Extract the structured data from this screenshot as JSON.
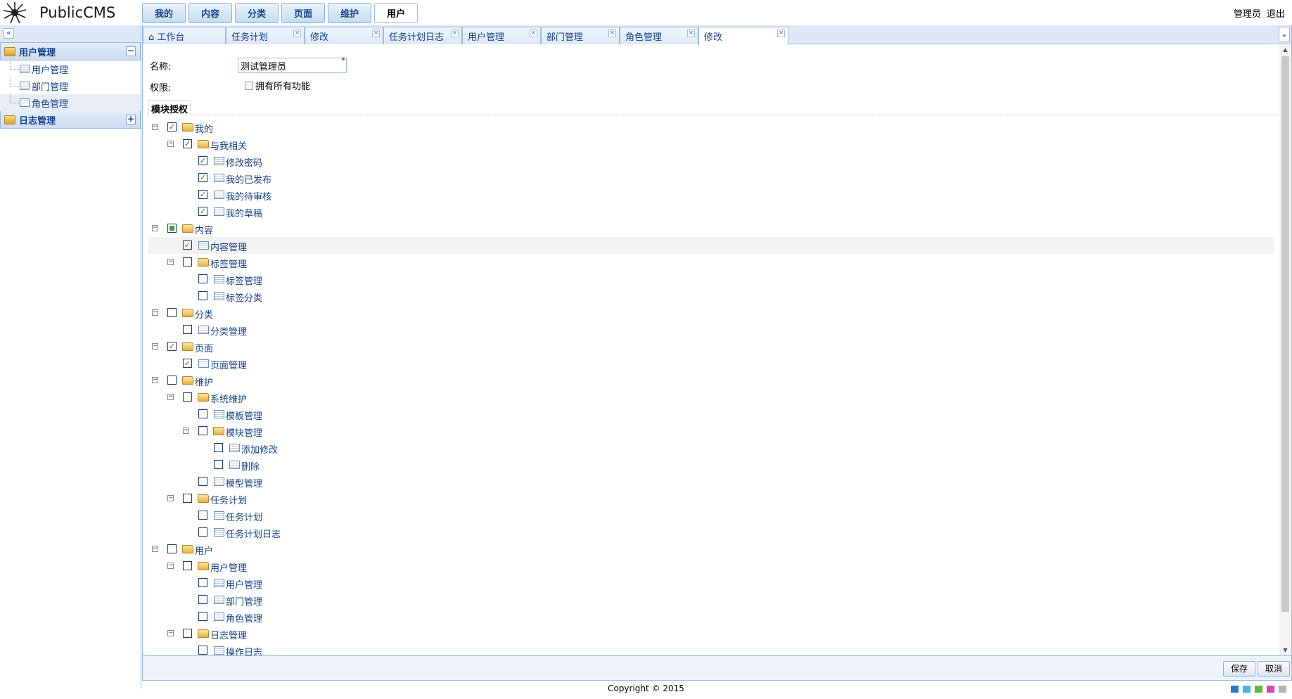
{
  "app": {
    "logo_text": "PublicCMS"
  },
  "nav": [
    {
      "label": "我的",
      "active": false
    },
    {
      "label": "内容",
      "active": false
    },
    {
      "label": "分类",
      "active": false
    },
    {
      "label": "页面",
      "active": false
    },
    {
      "label": "维护",
      "active": false
    },
    {
      "label": "用户",
      "active": true
    }
  ],
  "userbar": {
    "user": "管理员",
    "logout": "退出"
  },
  "sidebar": {
    "groups": [
      {
        "title": "用户管理",
        "toggle": "−",
        "items": [
          {
            "label": "用户管理",
            "selected": false
          },
          {
            "label": "部门管理",
            "selected": false
          },
          {
            "label": "角色管理",
            "selected": true
          }
        ]
      },
      {
        "title": "日志管理",
        "toggle": "+",
        "items": []
      }
    ]
  },
  "tabs": [
    {
      "label": "工作台",
      "closable": false,
      "active": false
    },
    {
      "label": "任务计划",
      "closable": true,
      "active": false
    },
    {
      "label": "修改",
      "closable": true,
      "active": false
    },
    {
      "label": "任务计划日志",
      "closable": true,
      "active": false
    },
    {
      "label": "用户管理",
      "closable": true,
      "active": false
    },
    {
      "label": "部门管理",
      "closable": true,
      "active": false
    },
    {
      "label": "角色管理",
      "closable": true,
      "active": false
    },
    {
      "label": "修改",
      "closable": true,
      "active": true
    }
  ],
  "form": {
    "name_label": "名称:",
    "name_value": "测试管理员",
    "required_mark": "*",
    "perm_label": "权限:",
    "all_perm_label": "拥有所有功能",
    "legend": "模块授权"
  },
  "tree": [
    {
      "label": "我的",
      "level": 0,
      "type": "folder",
      "state": "checked",
      "expand": true
    },
    {
      "label": "与我相关",
      "level": 1,
      "type": "folder",
      "state": "checked",
      "expand": true
    },
    {
      "label": "修改密码",
      "level": 2,
      "type": "page",
      "state": "checked"
    },
    {
      "label": "我的已发布",
      "level": 2,
      "type": "page",
      "state": "checked"
    },
    {
      "label": "我的待审核",
      "level": 2,
      "type": "page",
      "state": "checked"
    },
    {
      "label": "我的草稿",
      "level": 2,
      "type": "page",
      "state": "checked"
    },
    {
      "label": "内容",
      "level": 0,
      "type": "folder",
      "state": "partial",
      "expand": true
    },
    {
      "label": "内容管理",
      "level": 1,
      "type": "page",
      "state": "checked",
      "highlight": true
    },
    {
      "label": "标签管理",
      "level": 1,
      "type": "folder",
      "state": "unchecked",
      "expand": true
    },
    {
      "label": "标签管理",
      "level": 2,
      "type": "page",
      "state": "unchecked"
    },
    {
      "label": "标签分类",
      "level": 2,
      "type": "page",
      "state": "unchecked"
    },
    {
      "label": "分类",
      "level": 0,
      "type": "folder",
      "state": "unchecked",
      "expand": true
    },
    {
      "label": "分类管理",
      "level": 1,
      "type": "page",
      "state": "unchecked"
    },
    {
      "label": "页面",
      "level": 0,
      "type": "folder",
      "state": "checked",
      "expand": true
    },
    {
      "label": "页面管理",
      "level": 1,
      "type": "page",
      "state": "checked"
    },
    {
      "label": "维护",
      "level": 0,
      "type": "folder",
      "state": "unchecked",
      "expand": true
    },
    {
      "label": "系统维护",
      "level": 1,
      "type": "folder",
      "state": "unchecked",
      "expand": true
    },
    {
      "label": "模板管理",
      "level": 2,
      "type": "page",
      "state": "unchecked"
    },
    {
      "label": "模块管理",
      "level": 2,
      "type": "folder",
      "state": "unchecked",
      "expand": true
    },
    {
      "label": "添加修改",
      "level": 3,
      "type": "page",
      "state": "unchecked"
    },
    {
      "label": "删除",
      "level": 3,
      "type": "page",
      "state": "unchecked"
    },
    {
      "label": "模型管理",
      "level": 2,
      "type": "page",
      "state": "unchecked"
    },
    {
      "label": "任务计划",
      "level": 1,
      "type": "folder",
      "state": "unchecked",
      "expand": true
    },
    {
      "label": "任务计划",
      "level": 2,
      "type": "page",
      "state": "unchecked"
    },
    {
      "label": "任务计划日志",
      "level": 2,
      "type": "page",
      "state": "unchecked"
    },
    {
      "label": "用户",
      "level": 0,
      "type": "folder",
      "state": "unchecked",
      "expand": true
    },
    {
      "label": "用户管理",
      "level": 1,
      "type": "folder",
      "state": "unchecked",
      "expand": true
    },
    {
      "label": "用户管理",
      "level": 2,
      "type": "page",
      "state": "unchecked"
    },
    {
      "label": "部门管理",
      "level": 2,
      "type": "page",
      "state": "unchecked"
    },
    {
      "label": "角色管理",
      "level": 2,
      "type": "page",
      "state": "unchecked"
    },
    {
      "label": "日志管理",
      "level": 1,
      "type": "folder",
      "state": "unchecked",
      "expand": true
    },
    {
      "label": "操作日志",
      "level": 2,
      "type": "page",
      "state": "unchecked"
    }
  ],
  "buttons": {
    "save": "保存",
    "cancel": "取消"
  },
  "footer": {
    "copyright": "Copyright © 2015"
  },
  "themes": [
    "#2e76c8",
    "#49b3e6",
    "#63b63a",
    "#e040c0",
    "#b5b5b5"
  ]
}
